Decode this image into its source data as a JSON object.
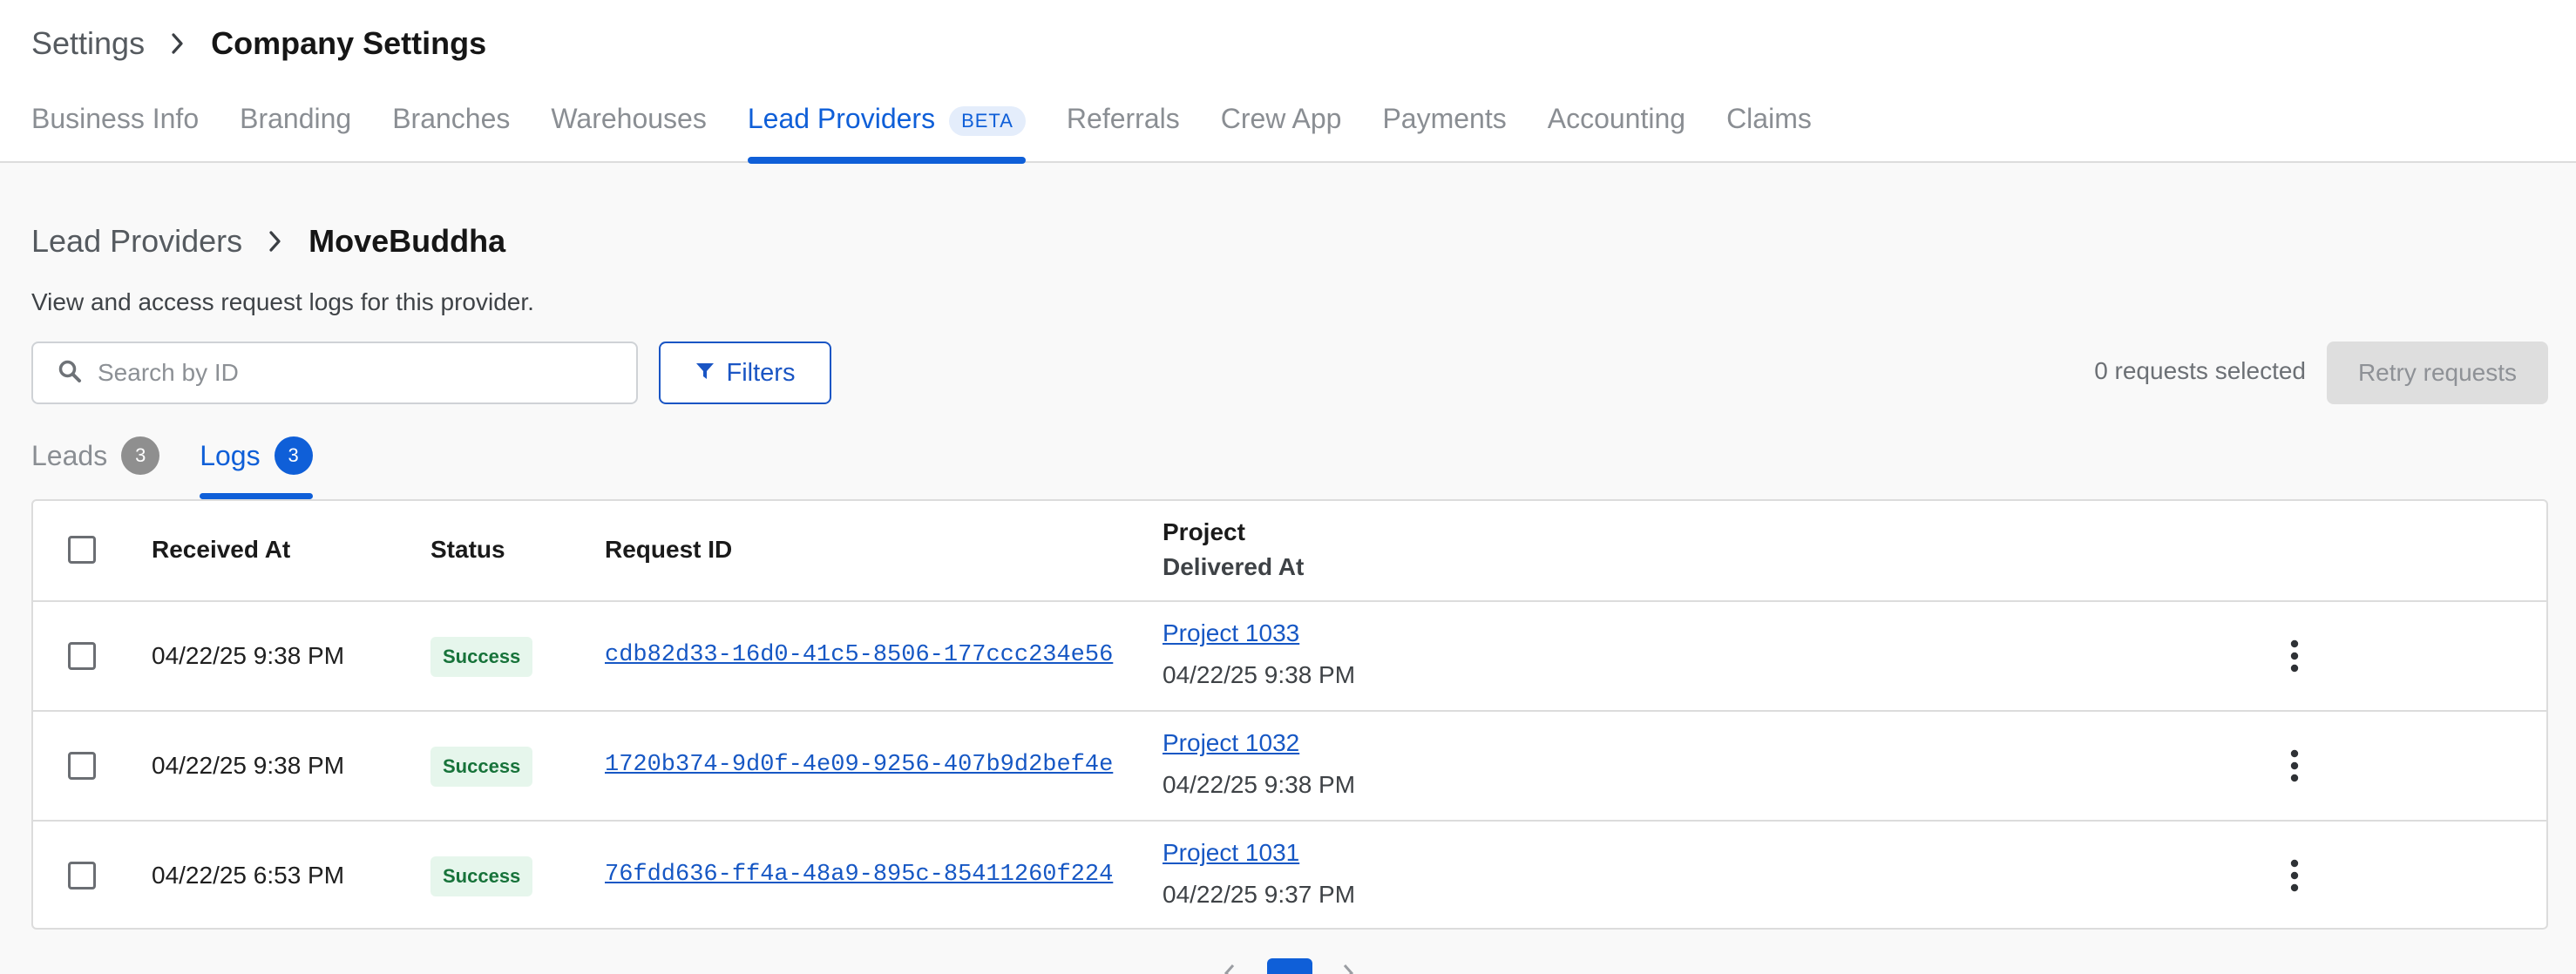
{
  "header": {
    "breadcrumb_root": "Settings",
    "breadcrumb_current": "Company Settings",
    "tabs": [
      {
        "label": "Business Info"
      },
      {
        "label": "Branding"
      },
      {
        "label": "Branches"
      },
      {
        "label": "Warehouses"
      },
      {
        "label": "Lead Providers",
        "badge": "BETA",
        "active": true
      },
      {
        "label": "Referrals"
      },
      {
        "label": "Crew App"
      },
      {
        "label": "Payments"
      },
      {
        "label": "Accounting"
      },
      {
        "label": "Claims"
      }
    ]
  },
  "page": {
    "breadcrumb_root": "Lead Providers",
    "breadcrumb_current": "MoveBuddha",
    "description": "View and access request logs for this provider."
  },
  "toolbar": {
    "search_placeholder": "Search by ID",
    "filters_label": "Filters",
    "selected_text": "0 requests selected",
    "retry_label": "Retry requests"
  },
  "subtabs": [
    {
      "label": "Leads",
      "count": "3",
      "active": false
    },
    {
      "label": "Logs",
      "count": "3",
      "active": true
    }
  ],
  "table": {
    "columns": {
      "received_at": "Received At",
      "status": "Status",
      "request_id": "Request ID",
      "project": "Project",
      "delivered_at": "Delivered At"
    },
    "rows": [
      {
        "received_at": "04/22/25 9:38 PM",
        "status": "Success",
        "request_id": "cdb82d33-16d0-41c5-8506-177ccc234e56",
        "project": "Project 1033",
        "delivered_at": "04/22/25 9:38 PM"
      },
      {
        "received_at": "04/22/25 9:38 PM",
        "status": "Success",
        "request_id": "1720b374-9d0f-4e09-9256-407b9d2bef4e",
        "project": "Project 1032",
        "delivered_at": "04/22/25 9:38 PM"
      },
      {
        "received_at": "04/22/25 6:53 PM",
        "status": "Success",
        "request_id": "76fdd636-ff4a-48a9-895c-85411260f224",
        "project": "Project 1031",
        "delivered_at": "04/22/25 9:37 PM"
      }
    ]
  },
  "colors": {
    "accent": "#0f5fd8",
    "success_text": "#17733a",
    "success_bg": "#e6f6ec"
  }
}
